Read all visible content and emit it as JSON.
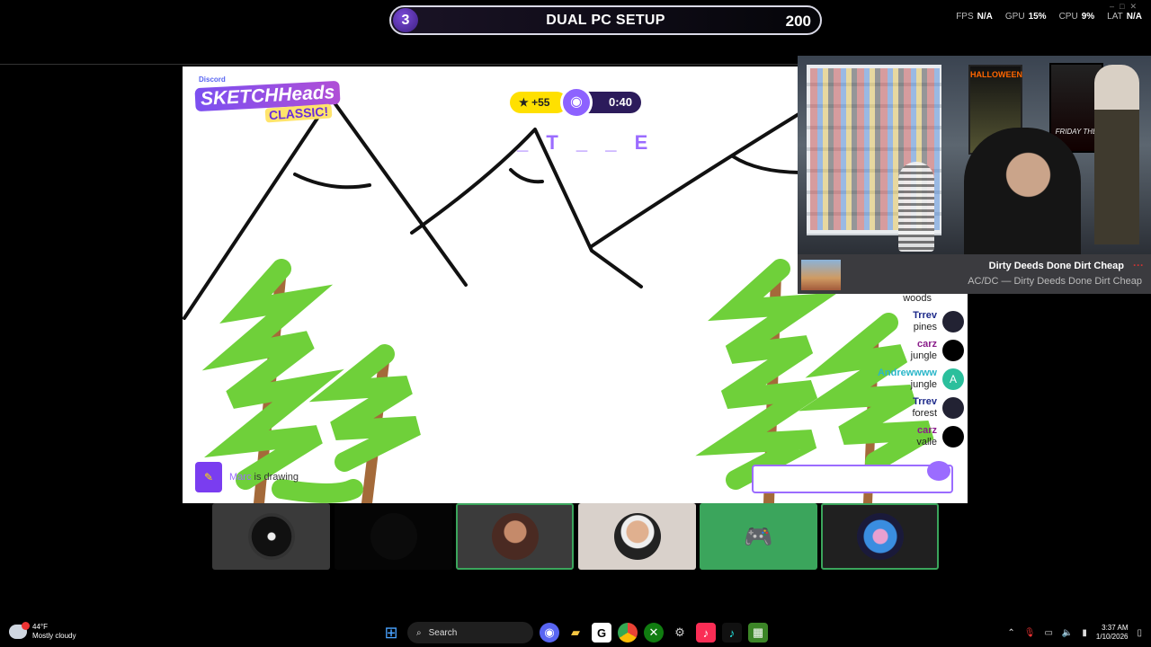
{
  "overlay": {
    "round": "3",
    "title": "DUAL PC SETUP",
    "score": "200",
    "stats": {
      "fps_label": "FPS",
      "fps": "N/A",
      "gpu_label": "GPU",
      "gpu": "15%",
      "cpu_label": "CPU",
      "cpu": "9%",
      "lat_label": "LAT",
      "lat": "N/A"
    }
  },
  "game": {
    "logo_brand": "Discord",
    "logo_title": "SKETCHHeads",
    "logo_sub": "CLASSIC!",
    "points": "+55",
    "timer": "0:40",
    "hint_word": "_ T _ _ E",
    "drawer_name": "Marc",
    "drawing_suffix": " is drawing",
    "chat_top": "woods",
    "chat": [
      {
        "name": "Trrev",
        "msg": "pines",
        "color": "#1d2a8a",
        "avatar": ""
      },
      {
        "name": "carz",
        "msg": "jungle",
        "color": "#8a1d8a",
        "avatar": ""
      },
      {
        "name": "Andrewwww",
        "msg": "jungle",
        "color": "#29b6c9",
        "avatar": "A"
      },
      {
        "name": "Trrev",
        "msg": "forest",
        "color": "#1d2a8a",
        "avatar": ""
      },
      {
        "name": "carz",
        "msg": "valle",
        "color": "#8a1d8a",
        "avatar": ""
      }
    ],
    "chat_input_value": ""
  },
  "webcam": {
    "poster1": "HALLOWEEN",
    "poster2": "FRIDAY THE"
  },
  "music": {
    "title": "Dirty Deeds Done Dirt Cheap",
    "artist_line": "AC/DC — Dirty Deeds Done Dirt Cheap"
  },
  "participants": [
    {
      "icon": "venom-avatar",
      "bg": "#3a3a3a",
      "border": ""
    },
    {
      "icon": "empty",
      "bg": "#050505",
      "border": ""
    },
    {
      "icon": "user-avatar",
      "bg": "#3b3b3b",
      "border": "#3ba55c"
    },
    {
      "icon": "user-avatar",
      "bg": "#d9d1cb",
      "border": ""
    },
    {
      "icon": "discord-icon",
      "bg": "#3ba55c",
      "border": ""
    },
    {
      "icon": "user-avatar",
      "bg": "#202020",
      "border": "#3ba55c"
    }
  ],
  "taskbar": {
    "temp": "44°F",
    "weather": "Mostly cloudy",
    "search_label": "Search",
    "time": "3:37 AM",
    "date": "1/10/2026"
  }
}
